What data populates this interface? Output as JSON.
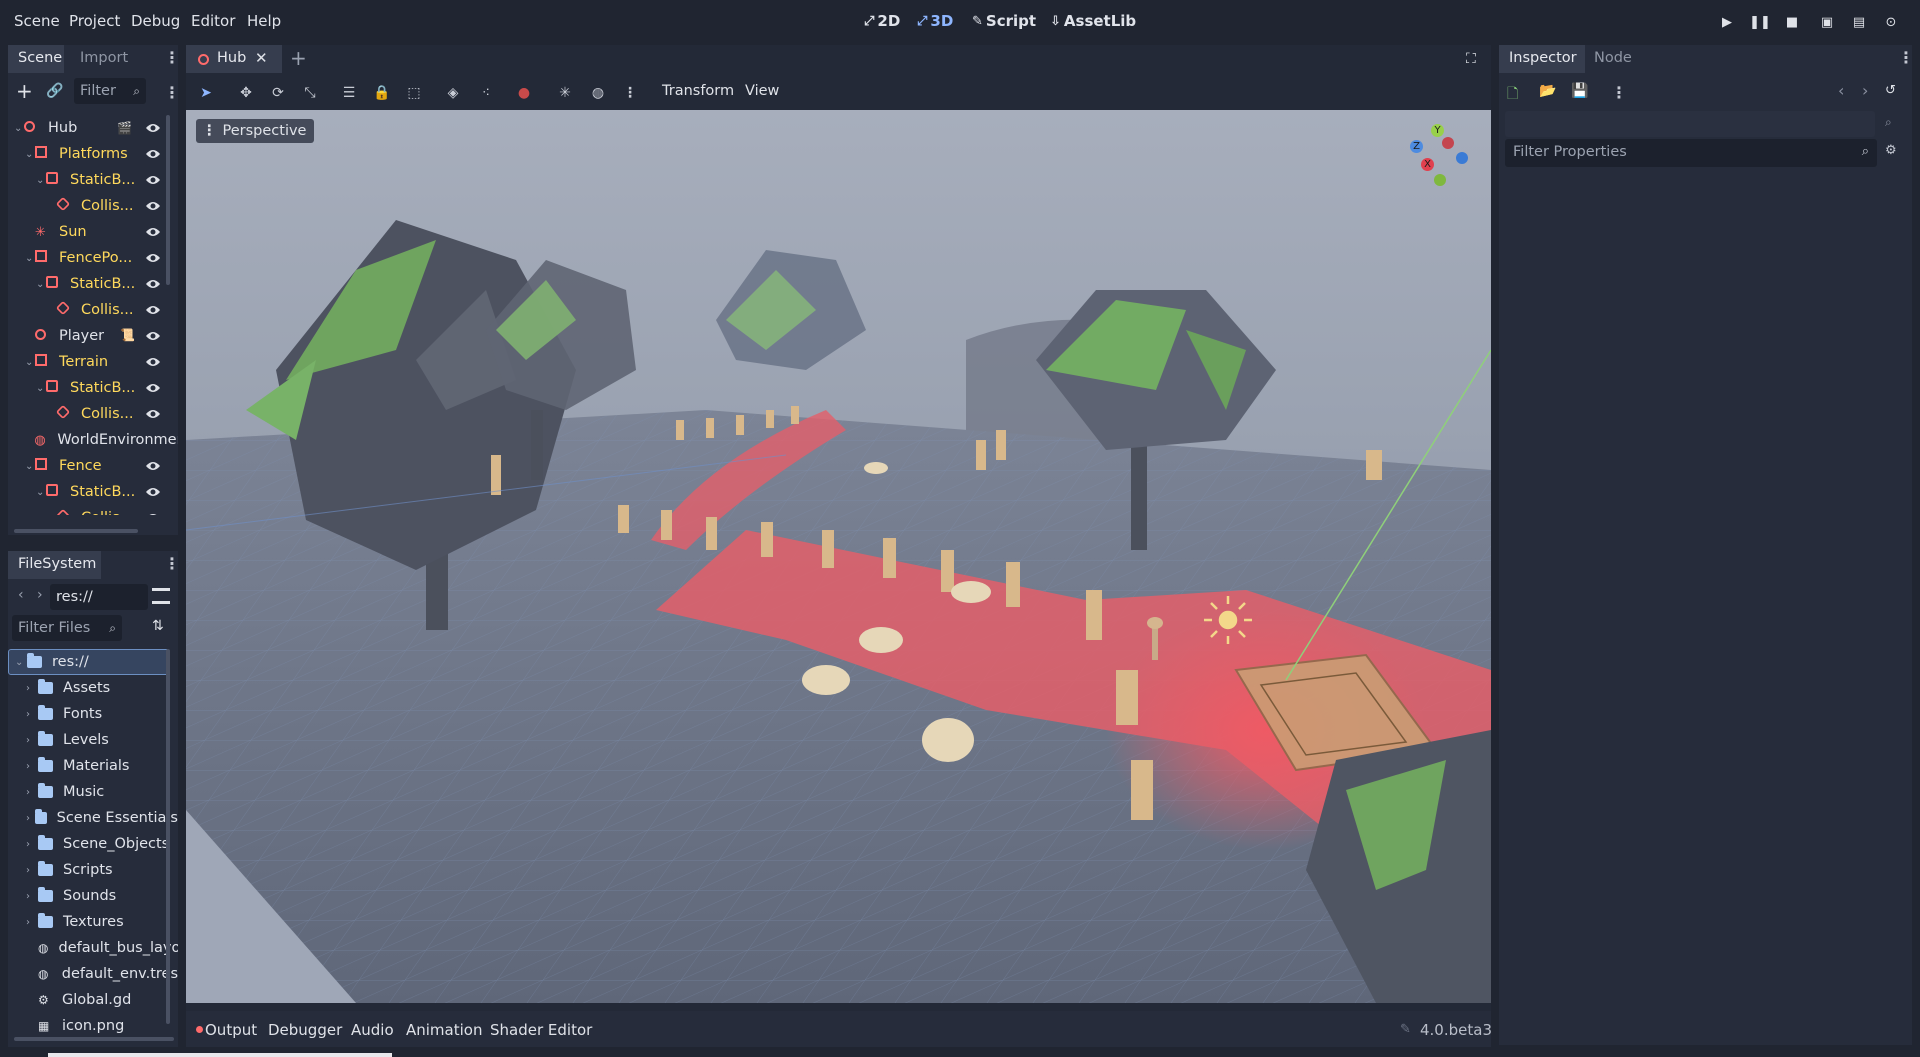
{
  "menubar": {
    "items": [
      "Scene",
      "Project",
      "Debug",
      "Editor",
      "Help"
    ],
    "workspaces": [
      {
        "label": "2D",
        "icon": "2d-icon"
      },
      {
        "label": "3D",
        "icon": "3d-icon",
        "active": true
      },
      {
        "label": "Script",
        "icon": "script-icon"
      },
      {
        "label": "AssetLib",
        "icon": "assetlib-icon"
      }
    ]
  },
  "scene_dock": {
    "tabs": [
      "Scene",
      "Import"
    ],
    "filter_placeholder": "Filter",
    "tree": [
      {
        "label": "Hub",
        "depth": 0,
        "icon": "node3d-icon",
        "expanded": true
      },
      {
        "label": "Platforms",
        "depth": 1,
        "icon": "mesh-instance-icon",
        "expanded": true
      },
      {
        "label": "StaticB...",
        "depth": 2,
        "icon": "static-body-icon",
        "expanded": true
      },
      {
        "label": "Collis...",
        "depth": 3,
        "icon": "collision-shape-icon"
      },
      {
        "label": "Sun",
        "depth": 1,
        "icon": "light-icon"
      },
      {
        "label": "FencePo...",
        "depth": 1,
        "icon": "mesh-instance-icon",
        "expanded": true
      },
      {
        "label": "StaticB...",
        "depth": 2,
        "icon": "static-body-icon",
        "expanded": true
      },
      {
        "label": "Collis...",
        "depth": 3,
        "icon": "collision-shape-icon"
      },
      {
        "label": "Player",
        "depth": 1,
        "icon": "node3d-icon"
      },
      {
        "label": "Terrain",
        "depth": 1,
        "icon": "mesh-instance-icon",
        "expanded": true
      },
      {
        "label": "StaticB...",
        "depth": 2,
        "icon": "static-body-icon",
        "expanded": true
      },
      {
        "label": "Collis...",
        "depth": 3,
        "icon": "collision-shape-icon"
      },
      {
        "label": "WorldEnvironment",
        "depth": 1,
        "icon": "world-environment-icon"
      },
      {
        "label": "Fence",
        "depth": 1,
        "icon": "mesh-instance-icon",
        "expanded": true
      },
      {
        "label": "StaticB...",
        "depth": 2,
        "icon": "static-body-icon",
        "expanded": true
      },
      {
        "label": "Collis...",
        "depth": 3,
        "icon": "collision-shape-icon"
      }
    ]
  },
  "filesystem": {
    "title": "FileSystem",
    "path": "res://",
    "filter_placeholder": "Filter Files",
    "items": [
      {
        "label": "res://",
        "type": "root"
      },
      {
        "label": "Assets",
        "type": "folder"
      },
      {
        "label": "Fonts",
        "type": "folder"
      },
      {
        "label": "Levels",
        "type": "folder"
      },
      {
        "label": "Materials",
        "type": "folder"
      },
      {
        "label": "Music",
        "type": "folder"
      },
      {
        "label": "Scene Essentials",
        "type": "folder"
      },
      {
        "label": "Scene_Objects",
        "type": "folder"
      },
      {
        "label": "Scripts",
        "type": "folder"
      },
      {
        "label": "Sounds",
        "type": "folder"
      },
      {
        "label": "Textures",
        "type": "folder"
      },
      {
        "label": "default_bus_layout",
        "type": "file"
      },
      {
        "label": "default_env.tres",
        "type": "file"
      },
      {
        "label": "Global.gd",
        "type": "file"
      },
      {
        "label": "icon.png",
        "type": "file"
      }
    ]
  },
  "editor": {
    "scene_tab": "Hub",
    "toolbar_menus": [
      "Transform",
      "View"
    ],
    "perspective_label": "Perspective",
    "gizmo_axes": [
      "Y",
      "Z",
      "X"
    ]
  },
  "bottom_panel": {
    "tabs": [
      "Output",
      "Debugger",
      "Audio",
      "Animation",
      "Shader Editor"
    ],
    "version": "4.0.beta3"
  },
  "inspector": {
    "tabs": [
      "Inspector",
      "Node"
    ],
    "filter_placeholder": "Filter Properties"
  },
  "colors": {
    "accent": "#8eb6ff",
    "node_red": "#ff6b6b",
    "label_yellow": "#ffd95c",
    "panel_bg": "#262c3b",
    "app_bg": "#202531"
  }
}
